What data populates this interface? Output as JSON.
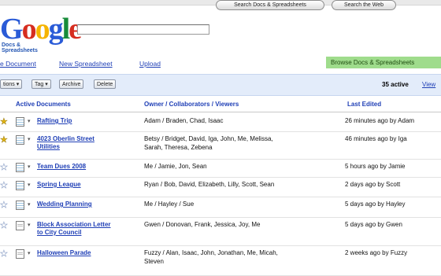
{
  "logo": {
    "letters": [
      "G",
      "o",
      "o",
      "g",
      "l",
      "e"
    ],
    "subtitle_line1": "Docs &",
    "subtitle_line2": "Spreadsheets"
  },
  "search": {
    "value": "",
    "search_docs_label": "Search Docs & Spreadsheets",
    "search_web_label": "Search the Web"
  },
  "actions": {
    "new_document": "e Document",
    "new_spreadsheet": "New Spreadsheet",
    "upload": "Upload",
    "browse": "Browse Docs & Spreadsheets"
  },
  "toolbar": {
    "actions": "tions",
    "tag": "Tag",
    "archive": "Archive",
    "delete": "Delete",
    "active_count": "35 active",
    "view": "View"
  },
  "table": {
    "headers": {
      "active_documents": "Active Documents",
      "owner": "Owner / Collaborators / Viewers",
      "last_edited": "Last Edited"
    },
    "rows": [
      {
        "starred": true,
        "kind": "sheet",
        "title_lines": [
          "Rafting Trip"
        ],
        "owners_lines": [
          "Adam / Braden, Chad, Isaac"
        ],
        "edited": "26 minutes ago by Adam"
      },
      {
        "starred": true,
        "kind": "sheet",
        "title_lines": [
          "4023 Oberlin Street",
          "Utilities"
        ],
        "owners_lines": [
          "Betsy / Bridget, David, Iga, John, Me, Melissa,",
          "Sarah, Theresa, Zebena"
        ],
        "edited": "46 minutes ago by Iga"
      },
      {
        "starred": false,
        "kind": "sheet",
        "title_lines": [
          "Team Dues 2008"
        ],
        "owners_lines": [
          "Me / Jamie, Jon, Sean"
        ],
        "edited": "5 hours ago by Jamie"
      },
      {
        "starred": false,
        "kind": "sheet",
        "title_lines": [
          "Spring League"
        ],
        "owners_lines": [
          "Ryan / Bob, David, Elizabeth, Lilly, Scott, Sean"
        ],
        "edited": "2 days ago by Scott"
      },
      {
        "starred": false,
        "kind": "sheet",
        "title_lines": [
          "Wedding Planning"
        ],
        "owners_lines": [
          "Me / Hayley / Sue"
        ],
        "edited": "5 days ago by Hayley"
      },
      {
        "starred": false,
        "kind": "word",
        "title_lines": [
          "Block Association Letter",
          "to City Council"
        ],
        "owners_lines": [
          "Gwen / Donovan, Frank, Jessica, Joy, Me"
        ],
        "edited": "5 days ago by Gwen"
      },
      {
        "starred": false,
        "kind": "word",
        "title_lines": [
          "Halloween Parade"
        ],
        "owners_lines": [
          "Fuzzy / Alan, Isaac, John, Jonathan, Me, Micah,",
          "Steven"
        ],
        "edited": "2 weeks ago by Fuzzy"
      }
    ]
  }
}
